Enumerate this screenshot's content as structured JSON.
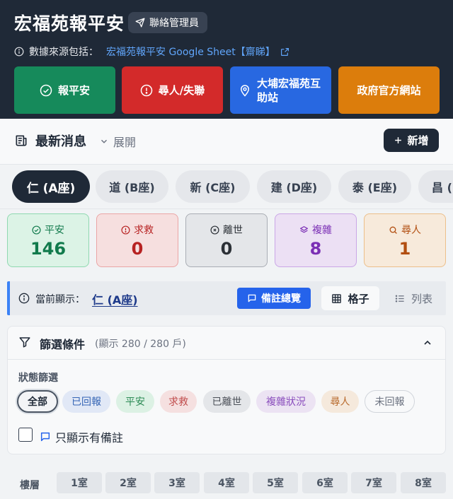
{
  "header": {
    "title": "宏福苑報平安",
    "contact_label": "聯絡管理員",
    "source_prefix": "數據來源包括：",
    "source_link": "宏福苑報平安 Google Sheet【齋睇】"
  },
  "actions": [
    {
      "label": "報平安",
      "color": "#168a5b"
    },
    {
      "label": "尋人/失聯",
      "color": "#d32a2a"
    },
    {
      "label": "大埔宏福苑互助站",
      "color": "#2868e1"
    },
    {
      "label": "政府官方網站",
      "color": "#dc7d0c"
    }
  ],
  "news": {
    "title": "最新消息",
    "expand_label": "展開",
    "add_label": "新增"
  },
  "tabs": [
    {
      "label": "仁 (A座)",
      "active": true
    },
    {
      "label": "道 (B座)"
    },
    {
      "label": "新 (C座)"
    },
    {
      "label": "建 (D座)"
    },
    {
      "label": "泰 (E座)"
    },
    {
      "label": "昌 (F座)"
    }
  ],
  "stats": [
    {
      "label": "平安",
      "value": "146",
      "bg": "#dcf3e6",
      "border": "#8fd8b0",
      "fg": "#117a4c",
      "icon": "check-circle-icon"
    },
    {
      "label": "求救",
      "value": "0",
      "bg": "#f6dfdf",
      "border": "#eaa5a5",
      "fg": "#b72222",
      "icon": "alert-circle-icon"
    },
    {
      "label": "離世",
      "value": "0",
      "bg": "#e4e6e9",
      "border": "#a9adb4",
      "fg": "#2b3036",
      "icon": "x-circle-icon"
    },
    {
      "label": "複雜",
      "value": "8",
      "bg": "#ece0f4",
      "border": "#caa6e6",
      "fg": "#7b2fb5",
      "icon": "layers-icon"
    },
    {
      "label": "尋人",
      "value": "1",
      "bg": "#f7eadb",
      "border": "#ecbf8a",
      "fg": "#b24e10",
      "icon": "search-icon"
    }
  ],
  "current": {
    "label": "當前顯示：",
    "value": "仁 (A座)",
    "notes_label": "備註總覽",
    "grid_label": "格子",
    "list_label": "列表"
  },
  "filter": {
    "title": "篩選條件",
    "count_text": "(顯示 280 / 280 戶)",
    "status_label": "狀態篩選",
    "chips": [
      {
        "label": "全部",
        "selected": true
      },
      {
        "label": "已回報",
        "bg": "#e1e8f6",
        "fg": "#3565b5"
      },
      {
        "label": "平安",
        "bg": "#dcf1e4",
        "fg": "#2b8a55"
      },
      {
        "label": "求救",
        "bg": "#f5e0e0",
        "fg": "#c04a4a"
      },
      {
        "label": "已離世",
        "bg": "#e4e6e9",
        "fg": "#4b5058"
      },
      {
        "label": "複雜狀況",
        "bg": "#ece3f3",
        "fg": "#8a4dbd"
      },
      {
        "label": "尋人",
        "bg": "#f5e9dc",
        "fg": "#b86a2c"
      },
      {
        "label": "未回報",
        "bg": "#f8f9fa",
        "fg": "#6b7280"
      }
    ],
    "notes_only_label": "只顯示有備註"
  },
  "grid": {
    "floor_label": "樓層",
    "rooms": [
      "1室",
      "2室",
      "3室",
      "4室",
      "5室",
      "6室",
      "7室",
      "8室"
    ]
  }
}
